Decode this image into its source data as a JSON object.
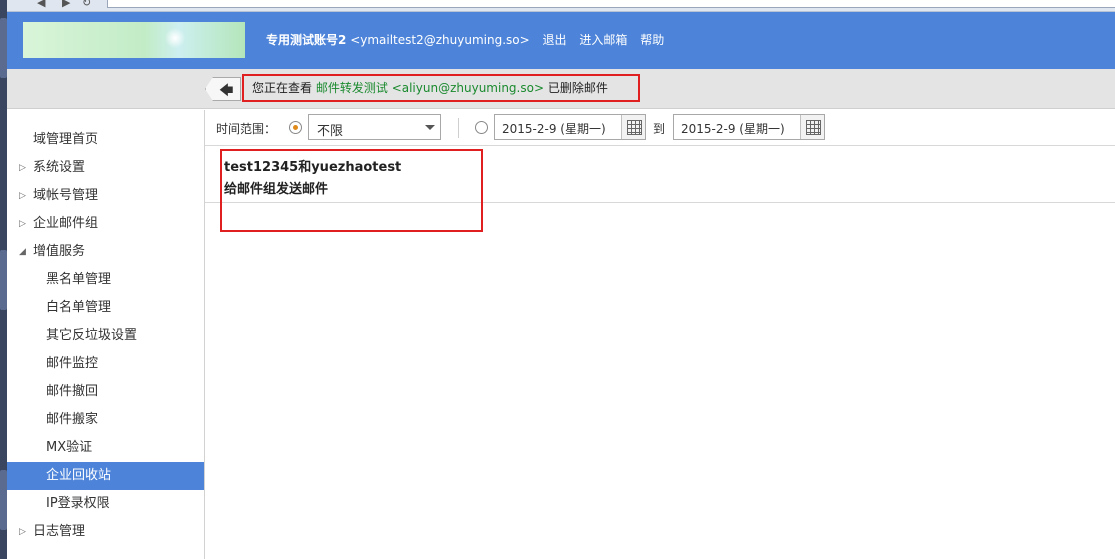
{
  "header": {
    "account_name": "专用测试账号2",
    "account_email": "<ymailtest2@zhuyuming.so>",
    "links": [
      "退出",
      "进入邮箱",
      "帮助"
    ]
  },
  "infobar": {
    "prefix": "您正在查看",
    "group_name": "邮件转发测试",
    "group_email": "<aliyun@zhuyuming.so>",
    "suffix": "已删除邮件"
  },
  "sidebar": {
    "items": [
      {
        "label": "域管理首页",
        "expandable": false
      },
      {
        "label": "系统设置",
        "expandable": true,
        "expanded": false
      },
      {
        "label": "域帐号管理",
        "expandable": true,
        "expanded": false
      },
      {
        "label": "企业邮件组",
        "expandable": true,
        "expanded": false
      },
      {
        "label": "增值服务",
        "expandable": true,
        "expanded": true
      },
      {
        "label": "黑名单管理",
        "sub": true
      },
      {
        "label": "白名单管理",
        "sub": true
      },
      {
        "label": "其它反垃圾设置",
        "sub": true
      },
      {
        "label": "邮件监控",
        "sub": true
      },
      {
        "label": "邮件撤回",
        "sub": true
      },
      {
        "label": "邮件搬家",
        "sub": true
      },
      {
        "label": "MX验证",
        "sub": true
      },
      {
        "label": "企业回收站",
        "sub": true,
        "active": true
      },
      {
        "label": "IP登录权限",
        "sub": true
      },
      {
        "label": "日志管理",
        "expandable": true,
        "expanded": false
      }
    ]
  },
  "filter": {
    "label": "时间范围：",
    "range_option": "不限",
    "range_selected": true,
    "date_from": "2015-2-9 (星期一)",
    "to_label": "到",
    "date_to": "2015-2-9 (星期一)"
  },
  "mails": [
    {
      "subject": "test12345和yuezhaotest",
      "description": "给邮件组发送邮件"
    }
  ],
  "colors": {
    "header_bg": "#4d84d9",
    "active_item_bg": "#4d84d9",
    "highlight_border": "#e02020",
    "group_text": "#1a8a2e"
  },
  "icons": {
    "back": "arrow-left-icon",
    "calendar": "calendar-icon",
    "dropdown": "chevron-down-icon",
    "tree_collapsed": "triangle-right-icon",
    "tree_expanded": "triangle-down-icon"
  }
}
